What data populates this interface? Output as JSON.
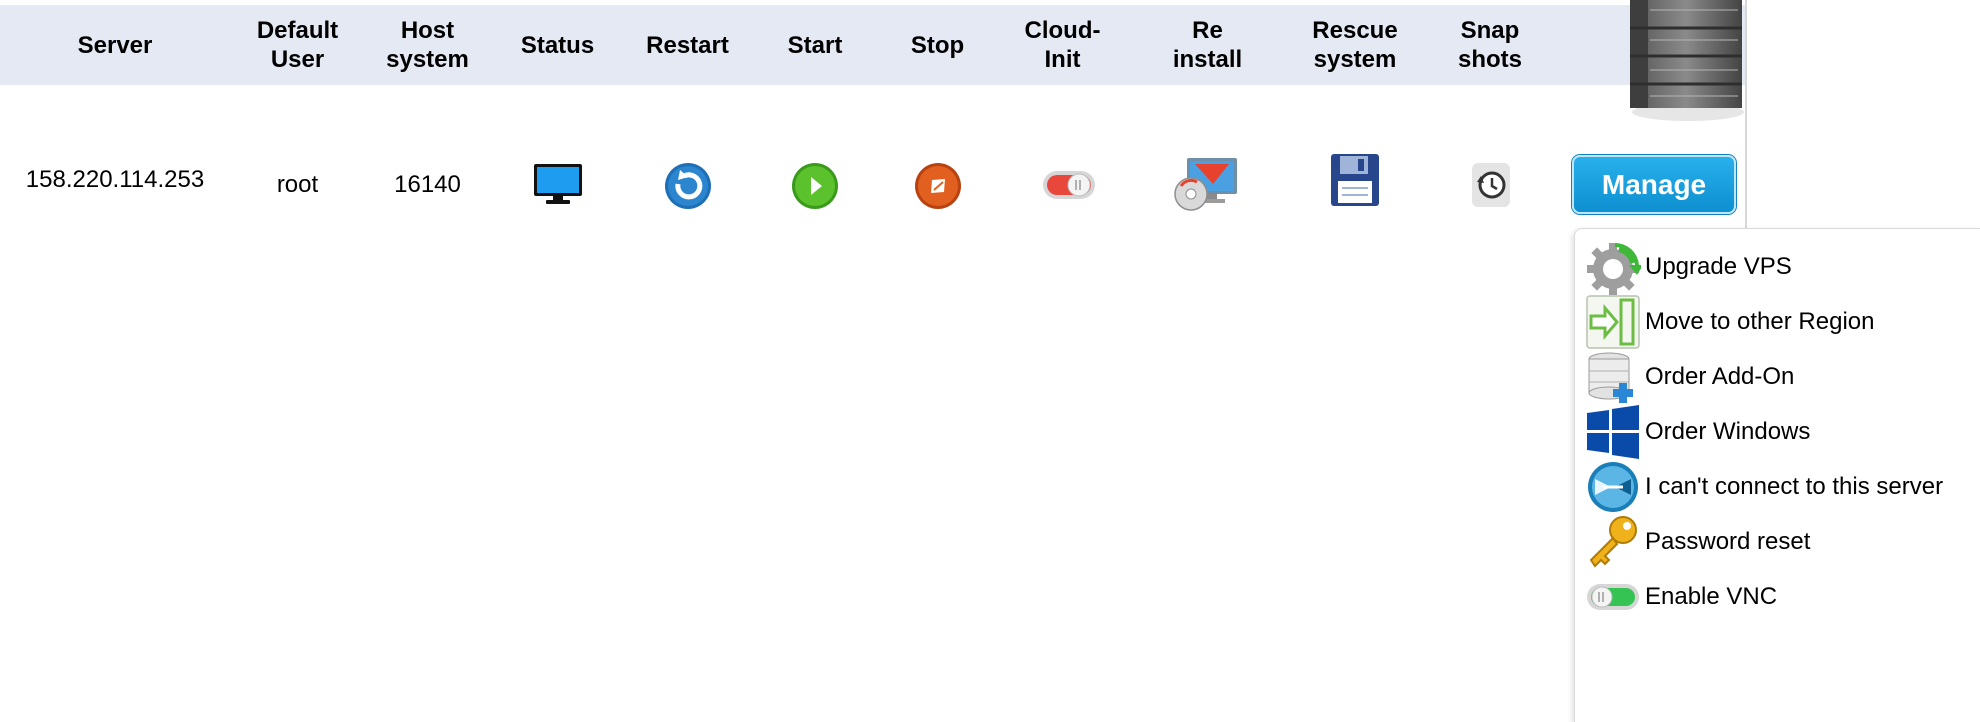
{
  "table": {
    "headers": [
      "Server",
      "Default\nUser",
      "Host\nsystem",
      "Status",
      "Restart",
      "Start",
      "Stop",
      "Cloud-\nInit",
      "Re\ninstall",
      "Rescue\nsystem",
      "Snap\nshots"
    ],
    "row": {
      "server": "158.220.114.253",
      "default_user": "root",
      "host_system": "16140"
    }
  },
  "icons": {
    "status": "monitor-icon",
    "restart": "restart-icon",
    "start": "play-icon",
    "stop": "stop-icon",
    "cloud_init": "toggle-off-icon",
    "reinstall": "reinstall-disc-icon",
    "rescue": "floppy-disk-icon",
    "snapshots": "snapshot-clock-icon"
  },
  "manage": {
    "label": "Manage"
  },
  "menu": {
    "items": [
      {
        "label": "Upgrade VPS",
        "icon": "upgrade-gear-icon"
      },
      {
        "label": "Move to other Region",
        "icon": "move-region-icon"
      },
      {
        "label": "Order Add-On",
        "icon": "database-add-icon"
      },
      {
        "label": "Order Windows",
        "icon": "windows-logo-icon"
      },
      {
        "label": "I can't connect to this server",
        "icon": "connect-help-icon"
      },
      {
        "label": "Password reset",
        "icon": "key-icon"
      },
      {
        "label": "Enable VNC",
        "icon": "toggle-on-icon"
      }
    ]
  },
  "colors": {
    "header_bg": "#e4e9f3",
    "manage_blue": "#1a9fe0",
    "toggle_off_red": "#e8473c",
    "toggle_on_green": "#35c454"
  }
}
